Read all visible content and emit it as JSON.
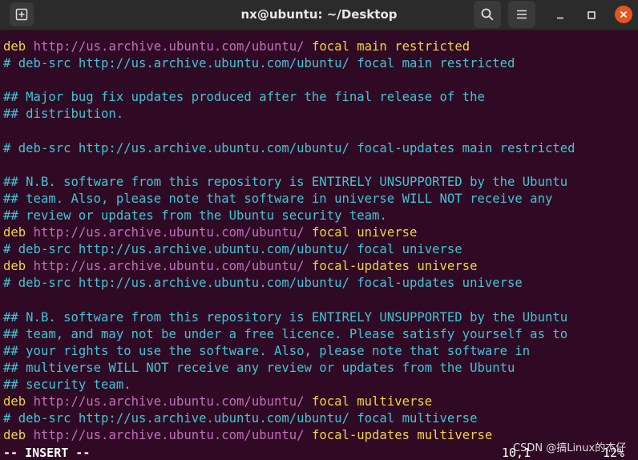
{
  "window": {
    "title": "nx@ubuntu: ~/Desktop",
    "icons": {
      "new_tab": "new-tab-icon",
      "search": "search-icon",
      "menu": "hamburger-menu-icon",
      "minimize": "minimize-icon",
      "maximize": "maximize-icon",
      "close": "close-icon"
    },
    "colors": {
      "titlebar": "#2b2b2b",
      "terminal_bg": "#300a24",
      "close": "#e95420",
      "keyword": "#f2d244",
      "url": "#c16fbe",
      "comment": "#3ec5d6"
    }
  },
  "editor": {
    "lines": [
      {
        "type": "deb",
        "prefix": "deb",
        "url": "http://us.archive.ubuntu.com/ubuntu/",
        "rest": "focal main restricted"
      },
      {
        "type": "comment",
        "text": "# deb-src http://us.archive.ubuntu.com/ubuntu/ focal main restricted"
      },
      {
        "type": "blank",
        "text": ""
      },
      {
        "type": "comment",
        "text": "## Major bug fix updates produced after the final release of the"
      },
      {
        "type": "comment",
        "text": "## distribution."
      },
      {
        "type": "blank",
        "text": ""
      },
      {
        "type": "comment",
        "text": "# deb-src http://us.archive.ubuntu.com/ubuntu/ focal-updates main restricted"
      },
      {
        "type": "blank",
        "text": ""
      },
      {
        "type": "comment",
        "text": "## N.B. software from this repository is ENTIRELY UNSUPPORTED by the Ubuntu"
      },
      {
        "type": "comment",
        "text": "## team. Also, please note that software in universe WILL NOT receive any"
      },
      {
        "type": "comment",
        "text": "## review or updates from the Ubuntu security team."
      },
      {
        "type": "deb",
        "prefix": "deb",
        "url": "http://us.archive.ubuntu.com/ubuntu/",
        "rest": "focal universe"
      },
      {
        "type": "comment",
        "text": "# deb-src http://us.archive.ubuntu.com/ubuntu/ focal universe"
      },
      {
        "type": "deb",
        "prefix": "deb",
        "url": "http://us.archive.ubuntu.com/ubuntu/",
        "rest": "focal-updates universe"
      },
      {
        "type": "comment",
        "text": "# deb-src http://us.archive.ubuntu.com/ubuntu/ focal-updates universe"
      },
      {
        "type": "blank",
        "text": ""
      },
      {
        "type": "comment",
        "text": "## N.B. software from this repository is ENTIRELY UNSUPPORTED by the Ubuntu"
      },
      {
        "type": "comment",
        "text": "## team, and may not be under a free licence. Please satisfy yourself as to"
      },
      {
        "type": "comment",
        "text": "## your rights to use the software. Also, please note that software in"
      },
      {
        "type": "comment",
        "text": "## multiverse WILL NOT receive any review or updates from the Ubuntu"
      },
      {
        "type": "comment",
        "text": "## security team."
      },
      {
        "type": "deb",
        "prefix": "deb",
        "url": "http://us.archive.ubuntu.com/ubuntu/",
        "rest": "focal multiverse"
      },
      {
        "type": "comment",
        "text": "# deb-src http://us.archive.ubuntu.com/ubuntu/ focal multiverse"
      },
      {
        "type": "deb",
        "prefix": "deb",
        "url": "http://us.archive.ubuntu.com/ubuntu/",
        "rest": "focal-updates multiverse"
      }
    ]
  },
  "status_bar": {
    "mode": "-- INSERT --",
    "position": "10,1",
    "percent": "12%"
  },
  "watermark": "CSDN @搞Linux的杰仔"
}
